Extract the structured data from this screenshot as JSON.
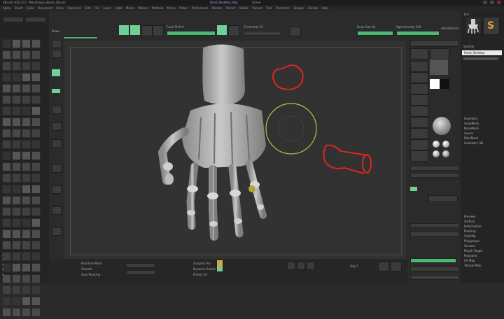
{
  "window": {
    "title": "ZBrush 2022.0.5 - Mecanique_Hands_Zbrush",
    "tabs": [
      "ZBrush 2022",
      "Hand_Skeleton_Wip",
      "Scene",
      "ZBrushCore"
    ]
  },
  "menu": {
    "items": [
      "Alpha",
      "Brush",
      "Color",
      "Document",
      "Draw",
      "Dynamics",
      "Edit",
      "File",
      "Layer",
      "Light",
      "Macro",
      "Marker",
      "Material",
      "Movie",
      "Picker",
      "Preferences",
      "Render",
      "Stencil",
      "Stroke",
      "Texture",
      "Tool",
      "Transform",
      "Zplugin",
      "Zscript",
      "Help"
    ]
  },
  "toolbar": {
    "mode_label": "Draw",
    "move_label": "Move",
    "scale_label": "Scale",
    "rotate_label": "Rotate",
    "mrgb_label": "Mrgb",
    "rgb_label": "Rgb",
    "zadd_label": "Zadd",
    "zsub_label": "Zsub",
    "zcut_label": "Zcut",
    "focal_label": "Focal Shift 0",
    "draw_size_label": "Draw Size 64",
    "dynamic_label": "Dynamic",
    "z_intensity_label": "Z Intensity 25",
    "rgb_intensity_label": "Rgb Intensity 100",
    "active_points": "ActivePoints: 1.243 Mil",
    "total_points": "TotalPoints: 1.243 Mil"
  },
  "left_shelf": {
    "labels": [
      "Edit",
      "Draw",
      "Move",
      "Scale",
      "Rotate",
      "Floor",
      "Local",
      "XYZ",
      "Frame",
      "Persp"
    ]
  },
  "right_shelf": {
    "labels": [
      "BPR",
      "SPix 3",
      "Scroll",
      "Zoom",
      "Actual",
      "AAHalf",
      "Dynamic",
      "Persp",
      "Floor",
      "Local",
      "Frame",
      "Move",
      "Scale",
      "Rotate",
      "Transp",
      "Solo",
      "Xpose"
    ]
  },
  "right_panel": {
    "header": "Tool",
    "subtool_title": "SubTool",
    "items": [
      "Hand_Skeleton",
      "Geometry",
      "ArrayMesh",
      "NanoMesh",
      "Layers",
      "FiberMesh",
      "Geometry HD",
      "Preview",
      "Surface",
      "Deformation",
      "Masking",
      "Visibility",
      "Polygroups",
      "Contact",
      "Morph Target",
      "Polypaint",
      "UV Map",
      "Texture Map"
    ],
    "selected": "Hand_Skeleton"
  },
  "bottom": {
    "left_labels": [
      "Backface Mask",
      "Smooth",
      "Auto Masking"
    ],
    "mid_labels": [
      "Sculptris Pro",
      "Dynamic Subdiv",
      "Project All"
    ],
    "right_labels": [
      "Poly F",
      "Transp",
      "Solo"
    ]
  },
  "colors": {
    "accent": "#6fcf97",
    "annotation": "#e0241f",
    "gizmo": "#b6c24a"
  }
}
